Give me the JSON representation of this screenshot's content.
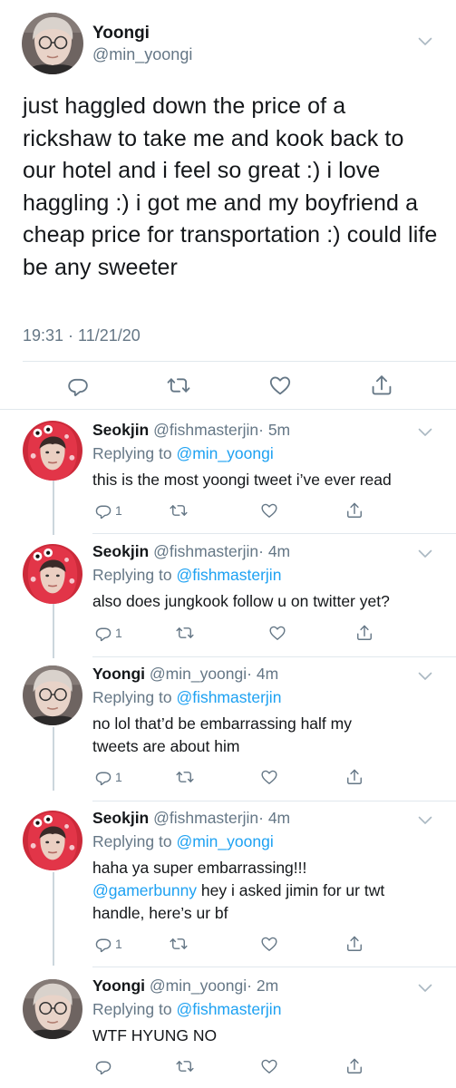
{
  "main_tweet": {
    "name": "Yoongi",
    "handle": "@min_yoongi",
    "text": "just haggled down the price of a rickshaw to take me and kook back to our hotel and i feel so great :) i love haggling :) i got me and my boyfriend a cheap price for transportation :) could life be any sweeter",
    "timestamp": "19:31 · 11/21/20"
  },
  "replies": [
    {
      "name": "Seokjin",
      "handle": "@fishmasterjin",
      "time": "· 5m",
      "replying_label": "Replying to",
      "replying_to": "@min_yoongi",
      "text": "this is the most yoongi tweet i’ve ever read",
      "reply_count": "1"
    },
    {
      "name": "Seokjin",
      "handle": "@fishmasterjin",
      "time": "· 4m",
      "replying_label": "Replying to",
      "replying_to": "@fishmasterjin",
      "text": "also does jungkook follow u on twitter yet?",
      "reply_count": "1"
    },
    {
      "name": "Yoongi",
      "handle": "@min_yoongi",
      "time": "· 4m",
      "replying_label": "Replying to",
      "replying_to": "@fishmasterjin",
      "text": "no lol that’d be embarrassing half my tweets are about him",
      "reply_count": "1"
    },
    {
      "name": "Seokjin",
      "handle": "@fishmasterjin",
      "time": "· 4m",
      "replying_label": "Replying to",
      "replying_to": "@min_yoongi",
      "text_line1": "haha ya super embarrassing!!!",
      "text_mention": "@gamerbunny",
      "text_rest": " hey i asked jimin for ur twt handle, here’s ur bf",
      "reply_count": "1"
    },
    {
      "name": "Yoongi",
      "handle": "@min_yoongi",
      "time": "· 2m",
      "replying_label": "Replying to",
      "replying_to": "@fishmasterjin",
      "text": "WTF HYUNG NO",
      "reply_count": ""
    }
  ],
  "icons": {
    "reply": "reply-icon",
    "retweet": "retweet-icon",
    "like": "heart-icon",
    "share": "share-icon",
    "more": "chevron-down-icon"
  },
  "colors": {
    "link": "#1da1f2",
    "secondary": "#657786",
    "divider": "#e1e8ed",
    "thread_line": "#ccd6dd"
  }
}
